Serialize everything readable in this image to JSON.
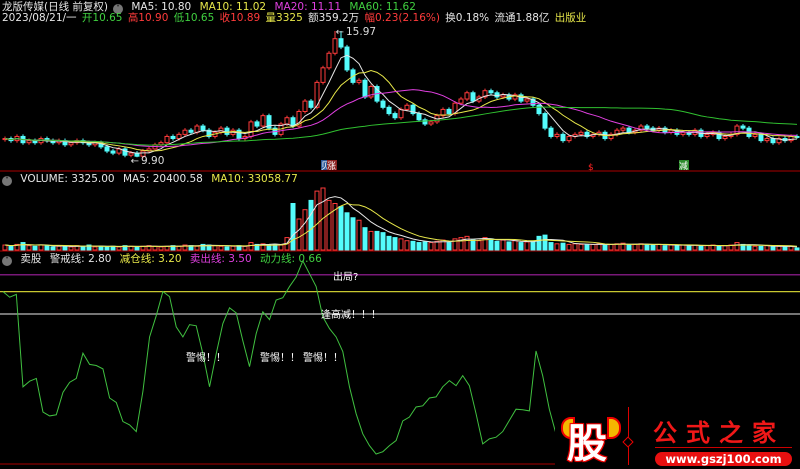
{
  "header": {
    "stock_name": "龙版传媒(日线 前复权)",
    "ma5": "MA5: 10.80",
    "ma10": "MA10: 11.02",
    "ma20": "MA20: 11.11",
    "ma60": "MA60: 11.62",
    "date": "2023/08/21/一",
    "open": "开10.65",
    "high": "高10.90",
    "low": "低10.65",
    "close": "收10.89",
    "volume": "量3325",
    "amount": "额359.2万",
    "change": "幅0.23(2.16%)",
    "turnover": "换0.18%",
    "float": "流通1.88亿",
    "industry": "出版业"
  },
  "volume_header": {
    "label": "VOLUME: 3325.00",
    "ma5": "MA5: 20400.58",
    "ma10": "MA10: 33058.77"
  },
  "indicator_header": {
    "name": "卖股",
    "warn": "警戒线: 2.80",
    "reduce": "减仓线: 3.20",
    "sell": "卖出线: 3.50",
    "power": "动力线: 0.66"
  },
  "annotations": {
    "price_high": "15.97",
    "price_low": "9.90",
    "signal_b": "贝",
    "signal_up": "涨",
    "signal_s": "$",
    "signal_reduce": "减",
    "exit": "出局?",
    "reduce_high": "逢高减！！！",
    "alert1": "警惕！！",
    "alert2": "警惕！！",
    "alert3": "警惕！！"
  },
  "logo": {
    "char": "股",
    "name": "公式之家",
    "url": "www.gszj100.com"
  },
  "colors": {
    "up": "#ff3b3b",
    "down": "#54fcfc",
    "ma5": "#e6e6e6",
    "ma10": "#e8e84a",
    "ma20": "#e040e0",
    "ma60": "#30c030",
    "power": "#40c040"
  },
  "chart_data": {
    "type": "candlestick",
    "closes": [
      10.8,
      10.7,
      10.9,
      10.6,
      10.7,
      10.6,
      10.8,
      10.7,
      10.6,
      10.7,
      10.5,
      10.6,
      10.7,
      10.6,
      10.5,
      10.6,
      10.4,
      10.2,
      10.1,
      10.3,
      10.0,
      10.1,
      9.95,
      10.2,
      10.3,
      10.5,
      10.6,
      10.9,
      10.8,
      11.0,
      11.2,
      11.1,
      11.4,
      11.2,
      10.9,
      11.1,
      11.3,
      11.0,
      11.2,
      10.8,
      10.9,
      11.6,
      11.4,
      11.9,
      11.3,
      11.0,
      11.5,
      11.8,
      11.4,
      12.1,
      12.6,
      12.3,
      13.5,
      14.2,
      14.9,
      15.6,
      15.2,
      14.1,
      13.5,
      13.6,
      12.8,
      13.3,
      12.6,
      12.3,
      12.0,
      11.8,
      12.2,
      12.4,
      12.0,
      11.7,
      11.5,
      11.6,
      11.9,
      12.2,
      12.0,
      12.5,
      12.7,
      13.0,
      12.6,
      12.8,
      13.1,
      13.0,
      12.8,
      12.9,
      12.7,
      12.9,
      12.6,
      12.7,
      12.4,
      12.0,
      11.3,
      10.9,
      11.0,
      10.7,
      10.9,
      11.0,
      11.1,
      10.9,
      11.0,
      11.1,
      10.8,
      11.0,
      11.2,
      11.3,
      11.1,
      11.2,
      11.4,
      11.3,
      11.2,
      11.3,
      11.1,
      11.2,
      11.0,
      11.1,
      11.0,
      11.2,
      10.9,
      11.0,
      11.1,
      10.8,
      10.9,
      11.0,
      11.4,
      11.3,
      10.9,
      11.0,
      10.7,
      10.8,
      10.6,
      10.8,
      10.7,
      10.9,
      10.89
    ],
    "volumes": [
      8000,
      6000,
      9000,
      12000,
      7000,
      6000,
      8000,
      7000,
      5000,
      6000,
      6000,
      5000,
      7000,
      6000,
      8000,
      5000,
      6000,
      5000,
      6000,
      5000,
      7000,
      6000,
      5000,
      6000,
      7000,
      6000,
      5000,
      6000,
      7000,
      6000,
      8000,
      7000,
      6000,
      9000,
      8000,
      7000,
      6000,
      5000,
      6000,
      7000,
      6000,
      12000,
      9000,
      10000,
      8000,
      9000,
      8000,
      20000,
      75000,
      50000,
      65000,
      80000,
      95000,
      100000,
      80000,
      75000,
      70000,
      60000,
      52000,
      48000,
      36000,
      30000,
      30000,
      28000,
      22000,
      20000,
      18000,
      15000,
      14000,
      12000,
      13000,
      12000,
      14000,
      16000,
      12000,
      18000,
      20000,
      22000,
      16000,
      15000,
      20000,
      18000,
      14000,
      16000,
      13000,
      15000,
      12000,
      13000,
      14000,
      22000,
      24000,
      12000,
      10000,
      11000,
      9000,
      10000,
      9000,
      8000,
      9000,
      10000,
      8000,
      9000,
      10000,
      11000,
      8000,
      9000,
      10000,
      9000,
      8000,
      9000,
      7000,
      8000,
      7000,
      8000,
      7000,
      8000,
      6000,
      7000,
      8000,
      6000,
      7000,
      8000,
      12000,
      9000,
      7000,
      6000,
      6000,
      7000,
      5000,
      6000,
      5000,
      6000,
      3325
    ],
    "price_high": 15.97,
    "price_low": 9.9,
    "indicator": {
      "levels": {
        "warn": 2.8,
        "reduce": 3.2,
        "sell": 3.5
      },
      "power_line_points": "approximate trace",
      "power_values": [
        3.2,
        3.1,
        3.15,
        1.5,
        1.6,
        1.65,
        1.05,
        0.98,
        1.0,
        1.4,
        1.58,
        1.65,
        2.1,
        1.9,
        1.88,
        1.82,
        1.3,
        1.22,
        0.88,
        0.82,
        0.7,
        1.42,
        2.39,
        2.77,
        3.2,
        3.11,
        2.57,
        2.39,
        2.61,
        2.59,
        2.09,
        1.5,
        2.09,
        2.63,
        2.91,
        2.82,
        2.32,
        1.86,
        2.45,
        2.84,
        2.7,
        3.05,
        3.09,
        3.29,
        3.46,
        3.75,
        3.52,
        3.29,
        2.75,
        2.54,
        2.39,
        2.13,
        1.5,
        1.02,
        0.66,
        0.45,
        0.3,
        0.34,
        0.45,
        0.54,
        0.89,
        0.96,
        1.14,
        1.16,
        1.3,
        1.32,
        1.5,
        1.61,
        1.52,
        1.7,
        1.52,
        1.02,
        0.48,
        0.57,
        0.6,
        0.7,
        0.9,
        1.1,
        1.09,
        1.07,
        2.14,
        1.7,
        1.1,
        0.66
      ]
    }
  }
}
